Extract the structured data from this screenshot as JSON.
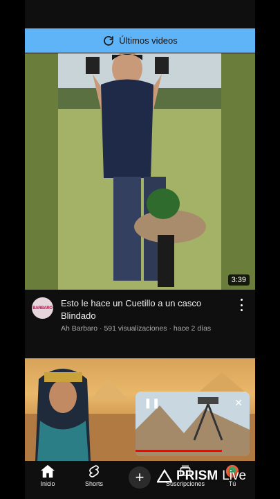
{
  "refresh_banner": {
    "label": "Últimos videos",
    "icon": "refresh-icon",
    "color": "#5fb3f7"
  },
  "video1": {
    "duration": "3:39",
    "title": "Esto le hace un Cuetillo a un casco Blindado",
    "channel": "Ah Barbaro",
    "views": "591 visualizaciones",
    "age": "hace 2 días",
    "separator": "·"
  },
  "nav": {
    "home": "Inicio",
    "shorts": "Shorts",
    "create": "+",
    "subscriptions": "Suscripciones",
    "you": "Tú"
  },
  "watermark": {
    "brand": "PRISM",
    "suffix": "Live"
  }
}
